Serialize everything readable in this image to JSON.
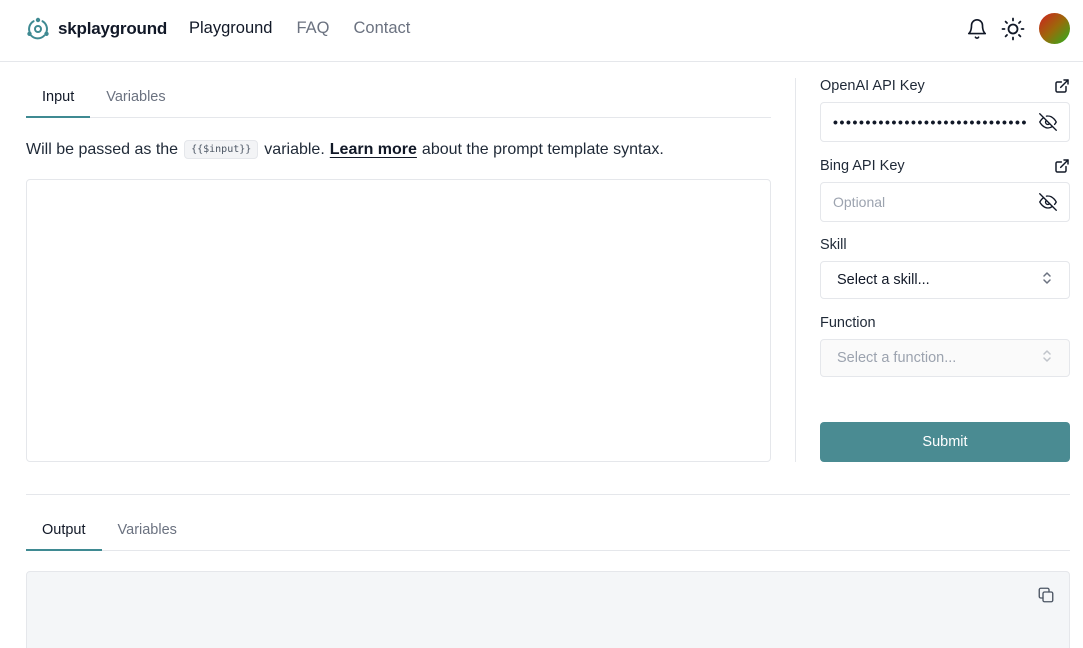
{
  "brand": {
    "name": "skplayground",
    "icon": "atom-logo-icon"
  },
  "nav": {
    "items": [
      "Playground",
      "FAQ",
      "Contact"
    ],
    "active": "Playground"
  },
  "header_icons": [
    "bell-icon",
    "sun-icon",
    "avatar"
  ],
  "input_section": {
    "tabs": [
      "Input",
      "Variables"
    ],
    "active_tab": "Input",
    "help_before": "Will be passed as the",
    "help_code": "{{$input}}",
    "help_mid": "variable.",
    "help_link": "Learn more",
    "help_after": "about the prompt template syntax.",
    "input_value": ""
  },
  "settings": {
    "openai": {
      "label": "OpenAI API Key",
      "value": "••••••••••••••••••••••••••••••"
    },
    "bing": {
      "label": "Bing API Key",
      "placeholder": "Optional"
    },
    "skill": {
      "label": "Skill",
      "value": "Select a skill..."
    },
    "function": {
      "label": "Function",
      "value": "Select a function..."
    },
    "submit_label": "Submit"
  },
  "output_section": {
    "tabs": [
      "Output",
      "Variables"
    ],
    "active_tab": "Output"
  },
  "colors": {
    "accent": "#4a8b92",
    "text": "#1f2937",
    "muted": "#6b7280",
    "border": "#e5e7eb",
    "output_bg": "#f4f6f8"
  }
}
